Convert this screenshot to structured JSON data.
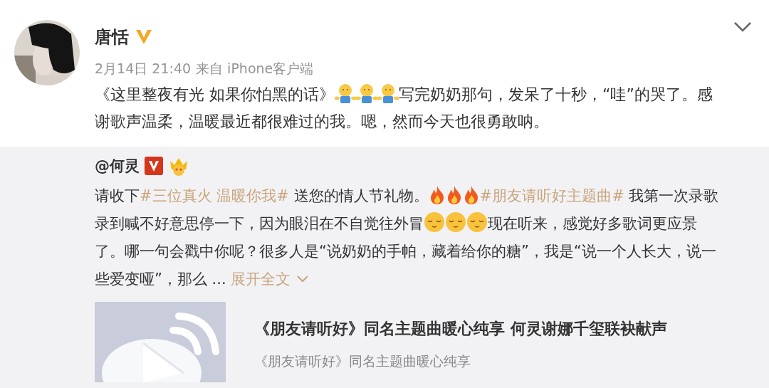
{
  "post": {
    "author": "唐恬",
    "verified": true,
    "time": "2月14日 21:40",
    "source": "来自 iPhone客户端",
    "content": [
      {
        "kind": "text",
        "text": "《这里整夜有光 如果你怕黑的话》"
      },
      {
        "kind": "hug"
      },
      {
        "kind": "hug"
      },
      {
        "kind": "hug"
      },
      {
        "kind": "text",
        "text": "写完奶奶那句，发呆了十秒，“哇”的哭了。感谢歌声温柔，温暖最近都很难过的我。嗯，然而今天也很勇敢呐。"
      }
    ]
  },
  "repost": {
    "author": "@何灵",
    "verified": true,
    "content": [
      {
        "kind": "text",
        "text": "请收下"
      },
      {
        "kind": "topic",
        "text": "#三位真火 温暖你我#"
      },
      {
        "kind": "text",
        "text": " 送您的情人节礼物。"
      },
      {
        "kind": "fire"
      },
      {
        "kind": "fire"
      },
      {
        "kind": "fire"
      },
      {
        "kind": "topic",
        "text": "#朋友请听好主题曲#"
      },
      {
        "kind": "text",
        "text": " 我第一次录歌录到喊不好意思停一下，因为眼泪在不自觉往外冒"
      },
      {
        "kind": "smile"
      },
      {
        "kind": "smile"
      },
      {
        "kind": "smile"
      },
      {
        "kind": "text",
        "text": "现在听来，感觉好多歌词更应景了。哪一句会戳中你呢？很多人是“说奶奶的手帕，藏着给你的糖”，我是“说一个人长大，说一些爱变哑”，那么 ... "
      }
    ],
    "expand": "展开全文",
    "card": {
      "title": "《朋友请听好》同名主题曲暖心纯享 何灵谢娜千玺联袂献声",
      "subtitle": "《朋友请听好》同名主题曲暖心纯享"
    }
  }
}
